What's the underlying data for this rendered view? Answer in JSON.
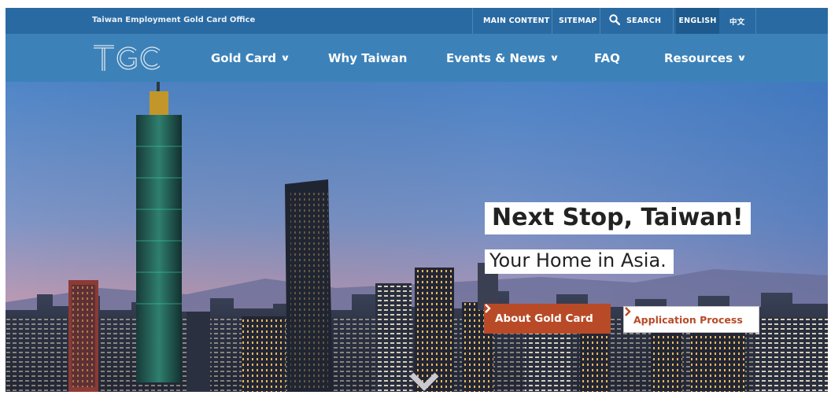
{
  "topbar": {
    "office_name": "Taiwan Employment Gold Card Office",
    "main_content": "MAIN CONTENT",
    "sitemap": "SITEMAP",
    "search": "SEARCH",
    "english": "ENGLISH",
    "chinese": "中文"
  },
  "nav": {
    "logo": "TGC",
    "items": [
      {
        "label": "Gold Card",
        "dropdown": true
      },
      {
        "label": "Why Taiwan",
        "dropdown": false
      },
      {
        "label": "Events & News",
        "dropdown": true
      },
      {
        "label": "FAQ",
        "dropdown": false
      },
      {
        "label": "Resources",
        "dropdown": true
      }
    ],
    "dropdown_icon": "chevron-down-icon"
  },
  "hero": {
    "headline": "Next Stop, Taiwan!",
    "subheadline": "Your Home in Asia.",
    "primary_button": "About Gold Card",
    "secondary_button": "Application Process",
    "button_icon": "chevron-right-icon",
    "scroll_icon": "chevron-down-icon"
  },
  "colors": {
    "topbar": "#2a6aa2",
    "navbar": "#3c82b9",
    "accent": "#b94a27"
  }
}
